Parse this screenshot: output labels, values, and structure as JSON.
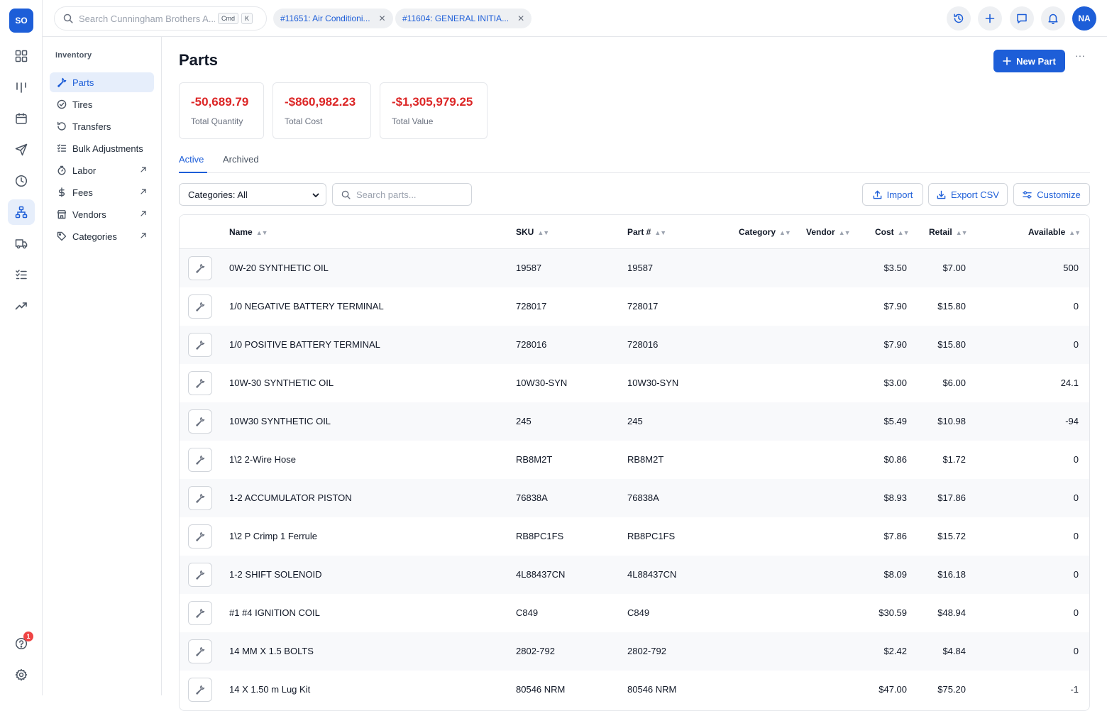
{
  "rail": {
    "logo": "SO",
    "notification_count": "1"
  },
  "topbar": {
    "search_placeholder": "Search Cunningham Brothers A...",
    "shortcut_cmd": "Cmd",
    "shortcut_key": "K",
    "open_tabs": [
      {
        "label": "#11651: Air Conditioni..."
      },
      {
        "label": "#11604: GENERAL INITIA..."
      }
    ],
    "avatar_initials": "NA"
  },
  "subnav": {
    "section_title": "Inventory",
    "items": [
      {
        "label": "Parts"
      },
      {
        "label": "Tires"
      },
      {
        "label": "Transfers"
      },
      {
        "label": "Bulk Adjustments"
      },
      {
        "label": "Labor"
      },
      {
        "label": "Fees"
      },
      {
        "label": "Vendors"
      },
      {
        "label": "Categories"
      }
    ]
  },
  "page": {
    "title": "Parts",
    "new_button": "New Part",
    "more": "···"
  },
  "stats": [
    {
      "value": "-50,689.79",
      "label": "Total Quantity"
    },
    {
      "value": "-$860,982.23",
      "label": "Total Cost"
    },
    {
      "value": "-$1,305,979.25",
      "label": "Total Value"
    }
  ],
  "tabs": [
    {
      "label": "Active"
    },
    {
      "label": "Archived"
    }
  ],
  "filters": {
    "category_select": "Categories: All",
    "search_placeholder": "Search parts...",
    "import_label": "Import",
    "export_label": "Export CSV",
    "customize_label": "Customize"
  },
  "table": {
    "columns": {
      "name": "Name",
      "sku": "SKU",
      "part_no": "Part #",
      "category": "Category",
      "vendor": "Vendor",
      "cost": "Cost",
      "retail": "Retail",
      "available": "Available"
    },
    "rows": [
      {
        "name": "0W-20 SYNTHETIC OIL",
        "sku": "19587",
        "part_no": "19587",
        "category": "",
        "vendor": "",
        "cost": "$3.50",
        "retail": "$7.00",
        "available": "500"
      },
      {
        "name": "1/0 NEGATIVE BATTERY TERMINAL",
        "sku": "728017",
        "part_no": "728017",
        "category": "",
        "vendor": "",
        "cost": "$7.90",
        "retail": "$15.80",
        "available": "0"
      },
      {
        "name": "1/0 POSITIVE BATTERY TERMINAL",
        "sku": "728016",
        "part_no": "728016",
        "category": "",
        "vendor": "",
        "cost": "$7.90",
        "retail": "$15.80",
        "available": "0"
      },
      {
        "name": "10W-30 SYNTHETIC OIL",
        "sku": "10W30-SYN",
        "part_no": "10W30-SYN",
        "category": "",
        "vendor": "",
        "cost": "$3.00",
        "retail": "$6.00",
        "available": "24.1"
      },
      {
        "name": "10W30 SYNTHETIC OIL",
        "sku": "245",
        "part_no": "245",
        "category": "",
        "vendor": "",
        "cost": "$5.49",
        "retail": "$10.98",
        "available": "-94"
      },
      {
        "name": "1\\2 2-Wire Hose",
        "sku": "RB8M2T",
        "part_no": "RB8M2T",
        "category": "",
        "vendor": "",
        "cost": "$0.86",
        "retail": "$1.72",
        "available": "0"
      },
      {
        "name": "1-2 ACCUMULATOR PISTON",
        "sku": "76838A",
        "part_no": "76838A",
        "category": "",
        "vendor": "",
        "cost": "$8.93",
        "retail": "$17.86",
        "available": "0"
      },
      {
        "name": "1\\2 P Crimp 1 Ferrule",
        "sku": "RB8PC1FS",
        "part_no": "RB8PC1FS",
        "category": "",
        "vendor": "",
        "cost": "$7.86",
        "retail": "$15.72",
        "available": "0"
      },
      {
        "name": "1-2 SHIFT SOLENOID",
        "sku": "4L88437CN",
        "part_no": "4L88437CN",
        "category": "",
        "vendor": "",
        "cost": "$8.09",
        "retail": "$16.18",
        "available": "0"
      },
      {
        "name": "#1 #4 IGNITION COIL",
        "sku": "C849",
        "part_no": "C849",
        "category": "",
        "vendor": "",
        "cost": "$30.59",
        "retail": "$48.94",
        "available": "0"
      },
      {
        "name": "14 MM X 1.5 BOLTS",
        "sku": "2802-792",
        "part_no": "2802-792",
        "category": "",
        "vendor": "",
        "cost": "$2.42",
        "retail": "$4.84",
        "available": "0"
      },
      {
        "name": "14 X 1.50 m Lug Kit",
        "sku": "80546 NRM",
        "part_no": "80546 NRM",
        "category": "",
        "vendor": "",
        "cost": "$47.00",
        "retail": "$75.20",
        "available": "-1"
      }
    ]
  }
}
